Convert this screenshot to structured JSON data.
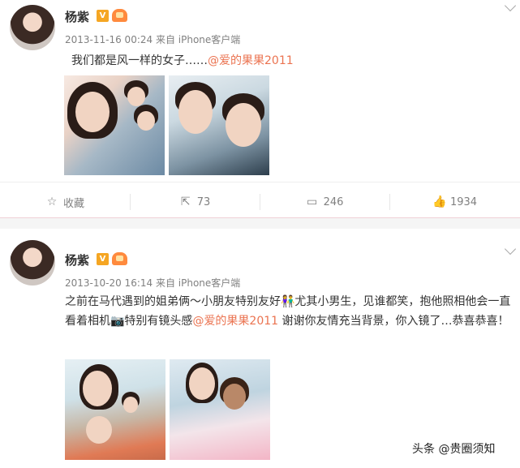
{
  "posts": [
    {
      "author": "杨紫",
      "verified_badge": "V",
      "timestamp": "2013-11-16 00:24",
      "source": "来自 iPhone客户端",
      "text_before": "我们都是风一样的女子……",
      "mention": "@爱的果果2011",
      "text_after": "",
      "actions": {
        "favorite_label": "收藏",
        "forward_count": "73",
        "comment_count": "246",
        "like_count": "1934"
      }
    },
    {
      "author": "杨紫",
      "verified_badge": "V",
      "timestamp": "2013-10-20 16:14",
      "source": "来自 iPhone客户端",
      "text_before": "之前在马代遇到的姐弟俩～小朋友特别友好👫尤其小男生，见谁都笑，抱他照相他会一直看着相机📷特别有镜头感",
      "mention": "@爱的果果2011",
      "text_after": " 谢谢你友情充当背景，你入镜了…恭喜恭喜！"
    }
  ],
  "watermark": "头条 @贵圈须知",
  "colors": {
    "mention": "#eb7350",
    "badge_v": "#f5a623",
    "meta_gray": "#808080"
  }
}
